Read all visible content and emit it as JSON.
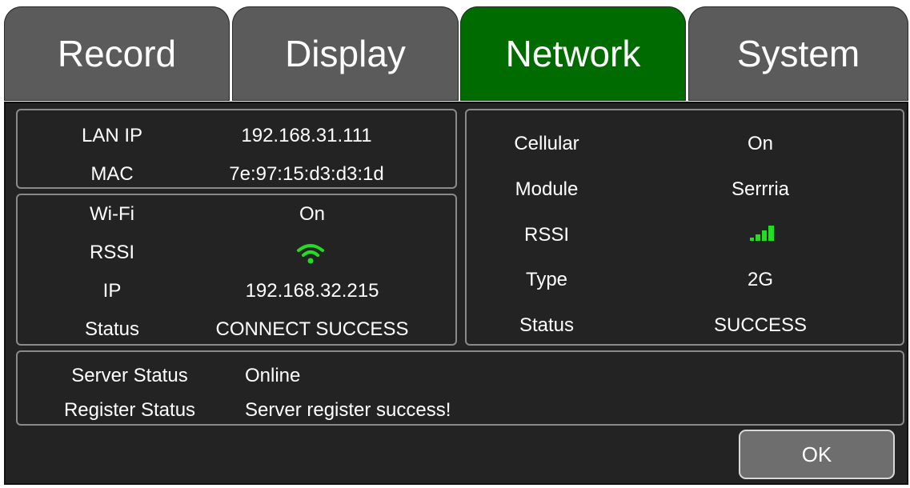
{
  "tabs": [
    {
      "label": "Record"
    },
    {
      "label": "Display"
    },
    {
      "label": "Network"
    },
    {
      "label": "System"
    }
  ],
  "active_tab": "Network",
  "colors": {
    "active_tab": "#006b00",
    "inactive_tab": "#5b5b5b",
    "signal": "#22dd22",
    "panel": "#232323"
  },
  "lan": {
    "ip_label": "LAN IP",
    "ip_value": "192.168.31.111",
    "mac_label": "MAC",
    "mac_value": "7e:97:15:d3:d3:1d"
  },
  "wifi": {
    "wifi_label": "Wi-Fi",
    "wifi_value": "On",
    "rssi_label": "RSSI",
    "rssi_icon": "wifi-signal-icon",
    "ip_label": "IP",
    "ip_value": "192.168.32.215",
    "status_label": "Status",
    "status_value": "CONNECT SUCCESS"
  },
  "cellular": {
    "cellular_label": "Cellular",
    "cellular_value": "On",
    "module_label": "Module",
    "module_value": "Serrria",
    "rssi_label": "RSSI",
    "rssi_icon": "cellular-signal-icon",
    "type_label": "Type",
    "type_value": "2G",
    "status_label": "Status",
    "status_value": "SUCCESS"
  },
  "server": {
    "server_status_label": "Server Status",
    "server_status_value": "Online",
    "register_status_label": "Register Status",
    "register_status_value": "Server register success!"
  },
  "ok_label": "OK"
}
